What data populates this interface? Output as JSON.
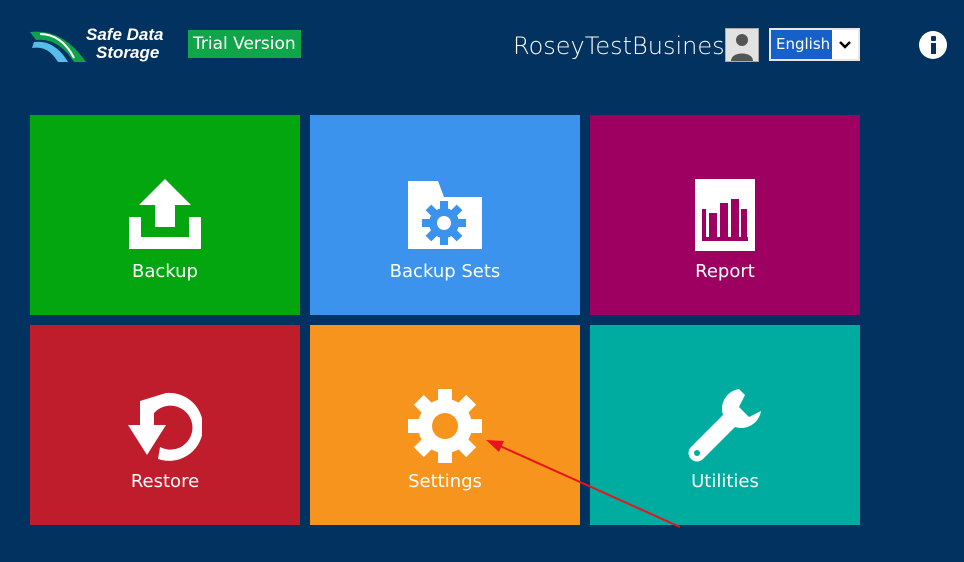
{
  "header": {
    "logo_line1": "Safe Data",
    "logo_line2": "Storage",
    "trial_badge": "Trial Version",
    "username": "RoseyTestBusiness",
    "language": "English"
  },
  "tiles": [
    {
      "label": "Backup",
      "color": "#03a60f",
      "icon": "upload-icon"
    },
    {
      "label": "Backup Sets",
      "color": "#3b93ee",
      "icon": "folder-gear-icon"
    },
    {
      "label": "Report",
      "color": "#9d0060",
      "icon": "bar-chart-icon"
    },
    {
      "label": "Restore",
      "color": "#bf1d2c",
      "icon": "restore-icon"
    },
    {
      "label": "Settings",
      "color": "#f7941d",
      "icon": "gear-icon"
    },
    {
      "label": "Utilities",
      "color": "#00aba0",
      "icon": "wrench-icon"
    }
  ],
  "colors": {
    "background": "#02325f",
    "trial_badge": "#11a54a",
    "language_select": "#1660c9",
    "annotation_arrow": "#e8141b"
  }
}
